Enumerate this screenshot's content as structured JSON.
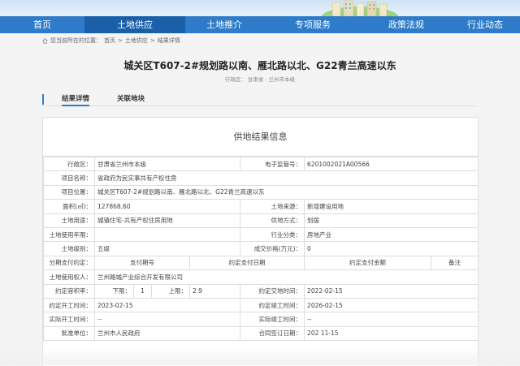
{
  "nav": {
    "items": [
      {
        "label": "首页",
        "active": false
      },
      {
        "label": "土地供应",
        "active": true
      },
      {
        "label": "土地推介",
        "active": false
      },
      {
        "label": "专项服务",
        "active": false
      },
      {
        "label": "政策法规",
        "active": false
      },
      {
        "label": "行业动态",
        "active": false
      }
    ]
  },
  "breadcrumb": {
    "prefix": "您当前所在的位置：",
    "home": "首页",
    "sep": ">",
    "section": "土地供应",
    "current": "结果详情"
  },
  "page": {
    "title": "城关区T607-2#规划路以南、雁北路以北、G22青兰高速以东",
    "region_label": "行政区：",
    "region_province": "甘肃省",
    "region_sep": "-",
    "region_city": "兰州市本级"
  },
  "tabs": [
    "结果详情",
    "关联地块"
  ],
  "panel_title": "供地结果信息",
  "rows": {
    "r1": {
      "l1": "行政区：",
      "v1": "甘肃省兰州市本级",
      "l2": "电子监管号：",
      "v2": "6201002021A00566"
    },
    "r2": {
      "l1": "项目名称：",
      "v1": "省政府为民实事共有产权住房"
    },
    "r3": {
      "l1": "项目位置：",
      "v1": "城关区T607-2#规划路以南、雁北路以北、G22青兰高速以东"
    },
    "r4": {
      "l1": "面积(㎡)：",
      "v1": "127868.60",
      "l2": "土地来源：",
      "v2": "新增建设用地"
    },
    "r5": {
      "l1": "土地用途：",
      "v1": "城镇住宅-共有产权住房用地",
      "l2": "供地方式：",
      "v2": "划拨"
    },
    "r6": {
      "l1": "土地使用年限：",
      "v1": "",
      "l2": "行业分类：",
      "v2": "房地产业"
    },
    "r7": {
      "l1": "土地级别：",
      "v1": "五级",
      "l2": "成交价格(万元)：",
      "v2": "0"
    },
    "r8": {
      "l1": "分期支付约定：",
      "h1": "支付期号",
      "h2": "约定支付日期",
      "h3": "约定支付金额",
      "h4": "备注"
    },
    "r9": {
      "l1": "土地使用权人：",
      "v1": "兰州路城产业综合开发有限公司"
    },
    "r10": {
      "l1": "约定容积率：",
      "lo_label": "下限：",
      "lo": "1",
      "hi_label": "上限：",
      "hi": "2.9",
      "l2": "约定交地时间：",
      "v2": "2022-02-15"
    },
    "r11": {
      "l1": "约定开工时间：",
      "v1": "2023-02-15",
      "l2": "约定竣工时间：",
      "v2": "2026-02-15"
    },
    "r12": {
      "l1": "实际开工时间：",
      "v1": "--",
      "l2": "实际竣工时间：",
      "v2": "--"
    },
    "r13": {
      "l1": "批准单位：",
      "v1": "兰州市人民政府",
      "l2": "合同签订日期：",
      "v2": "202  11-15"
    }
  }
}
